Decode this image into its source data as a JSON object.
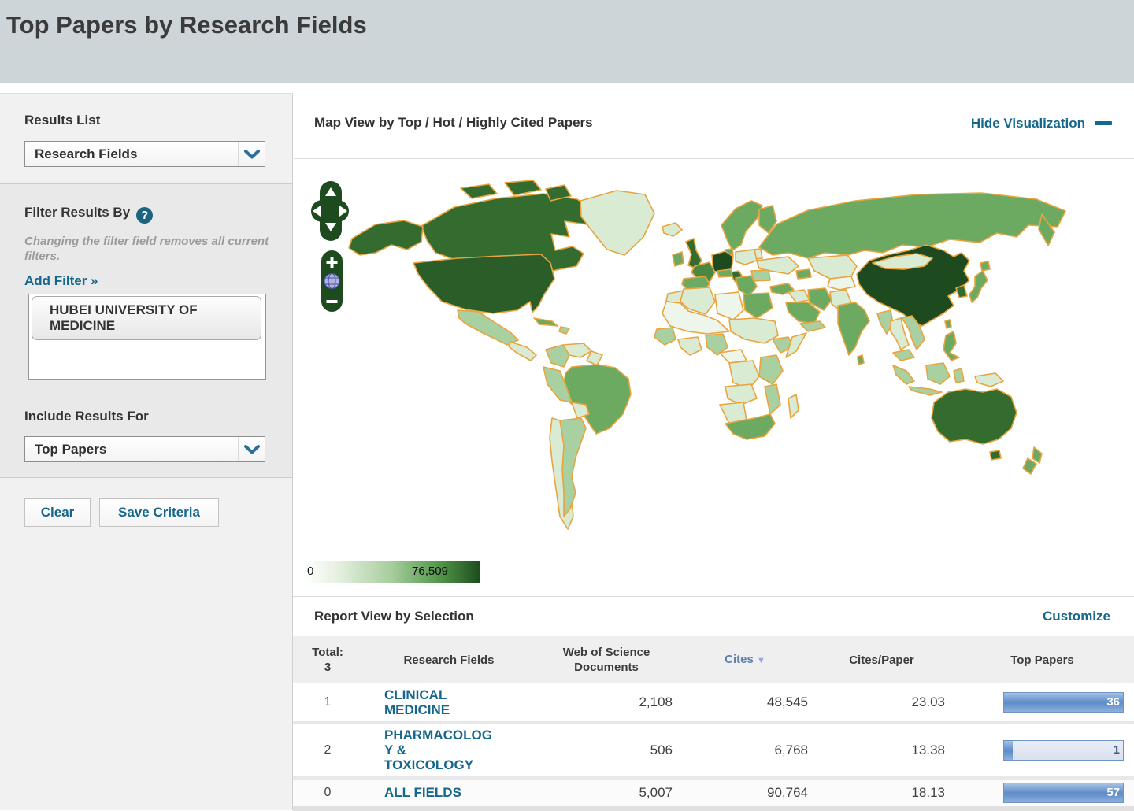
{
  "page": {
    "title": "Top Papers by Research Fields"
  },
  "sidebar": {
    "results_list": {
      "label": "Results List",
      "selected": "Research Fields"
    },
    "filter": {
      "label": "Filter Results By",
      "help_icon": "?",
      "note": "Changing the filter field removes all current filters.",
      "add_filter": "Add Filter »",
      "chip": "HUBEI UNIVERSITY OF MEDICINE"
    },
    "include": {
      "label": "Include Results For",
      "selected": "Top Papers"
    },
    "buttons": {
      "clear": "Clear",
      "save": "Save Criteria"
    }
  },
  "visualization": {
    "title": "Map View by Top / Hot / Highly Cited Papers",
    "hide_label": "Hide Visualization",
    "legend": {
      "min_label": "0",
      "max_label": "76,509",
      "start_color": "#FFFFFF",
      "end_color": "#1D4B1E"
    },
    "map": {
      "border_color": "#E8A43E",
      "palette": {
        "l5": "#1E4A1F",
        "l45": "#2A5D28",
        "l4": "#346C2F",
        "l35": "#4C8741",
        "l3": "#6CAA62",
        "l2": "#A9D0A1",
        "l1": "#D9EBD3",
        "l0": "#EEF6EB",
        "none": "#FFFFFF"
      },
      "regions": {
        "alaska": "l4",
        "canada": "l4",
        "arctic-1": "l4",
        "arctic-2": "l4",
        "arctic-3": "l4",
        "greenland": "l1",
        "usa": "l45",
        "mexico": "l2",
        "central-america": "l1",
        "cuba": "l3",
        "hispaniola": "l2",
        "colombia": "l2",
        "venezuela": "l1",
        "guyanas": "l1",
        "brazil": "l3",
        "peru": "l2",
        "bolivia": "l1",
        "chile": "l1",
        "argentina": "l2",
        "iceland": "l1",
        "ireland": "l3",
        "uk": "l4",
        "norway-sweden": "l3",
        "finland": "l3",
        "denmark": "l3",
        "germany": "l5",
        "poland": "l1",
        "france": "l35",
        "spain": "l3",
        "italy": "l4",
        "austria": "l3",
        "balkans": "l3",
        "greece": "l3",
        "ukraine": "l1",
        "belarus": "l1",
        "romania": "l2",
        "russia": "l3",
        "kamchatka": "l3",
        "kazakhstan": "l1",
        "central-asia": "l0",
        "caucasus": "l3",
        "turkey": "l3",
        "syria-iraq": "l1",
        "iran": "l3",
        "afghanistan-pakistan": "l1",
        "saudi-arabia": "l3",
        "yemen-oman": "l2",
        "india": "l3",
        "sri-lanka": "l3",
        "china": "l5",
        "mongolia": "l1",
        "korea": "l4",
        "japan": "l3",
        "hokkaido": "l3",
        "taiwan": "l3",
        "myanmar": "l2",
        "thailand": "l1",
        "vietnam": "l2",
        "malaysia": "l2",
        "sumatra": "l2",
        "java": "l2",
        "borneo": "l2",
        "sulawesi": "l2",
        "philippines": "l3",
        "new-guinea": "l1",
        "australia": "l4",
        "tasmania": "l4",
        "new-zealand": "l3",
        "morocco": "l1",
        "algeria": "l1",
        "libya": "l0",
        "egypt": "l3",
        "west-africa": "l0",
        "senegal-guinea": "l2",
        "ivory-ghana": "l1",
        "nigeria": "l2",
        "chad-sudan": "l1",
        "ethiopia": "l2",
        "somalia": "l1",
        "cameroon-car": "l0",
        "drc": "l1",
        "kenya-tanzania": "l2",
        "angola-zambia": "l1",
        "mozambique": "l2",
        "namibia-botswana": "l1",
        "south-africa": "l3",
        "madagascar": "l1"
      }
    }
  },
  "report": {
    "title": "Report View by Selection",
    "customize": "Customize",
    "total_label": "Total:",
    "total_value": "3",
    "columns": {
      "field": "Research Fields",
      "documents": "Web of Science Documents",
      "cites": "Cites",
      "cites_per_paper": "Cites/Paper",
      "top_papers": "Top Papers"
    },
    "sorted_column": "Cites",
    "rows": [
      {
        "rank": "1",
        "field": "CLINICAL MEDICINE",
        "documents": "2,108",
        "cites": "48,545",
        "cites_per_paper": "23.03",
        "top_papers": "36",
        "bar_fill_pct": 100
      },
      {
        "rank": "2",
        "field": "PHARMACOLOGY & TOXICOLOGY",
        "documents": "506",
        "cites": "6,768",
        "cites_per_paper": "13.38",
        "top_papers": "1",
        "bar_fill_pct": 7
      },
      {
        "rank": "0",
        "field": "ALL FIELDS",
        "documents": "5,007",
        "cites": "90,764",
        "cites_per_paper": "18.13",
        "top_papers": "57",
        "bar_fill_pct": 100
      }
    ]
  }
}
